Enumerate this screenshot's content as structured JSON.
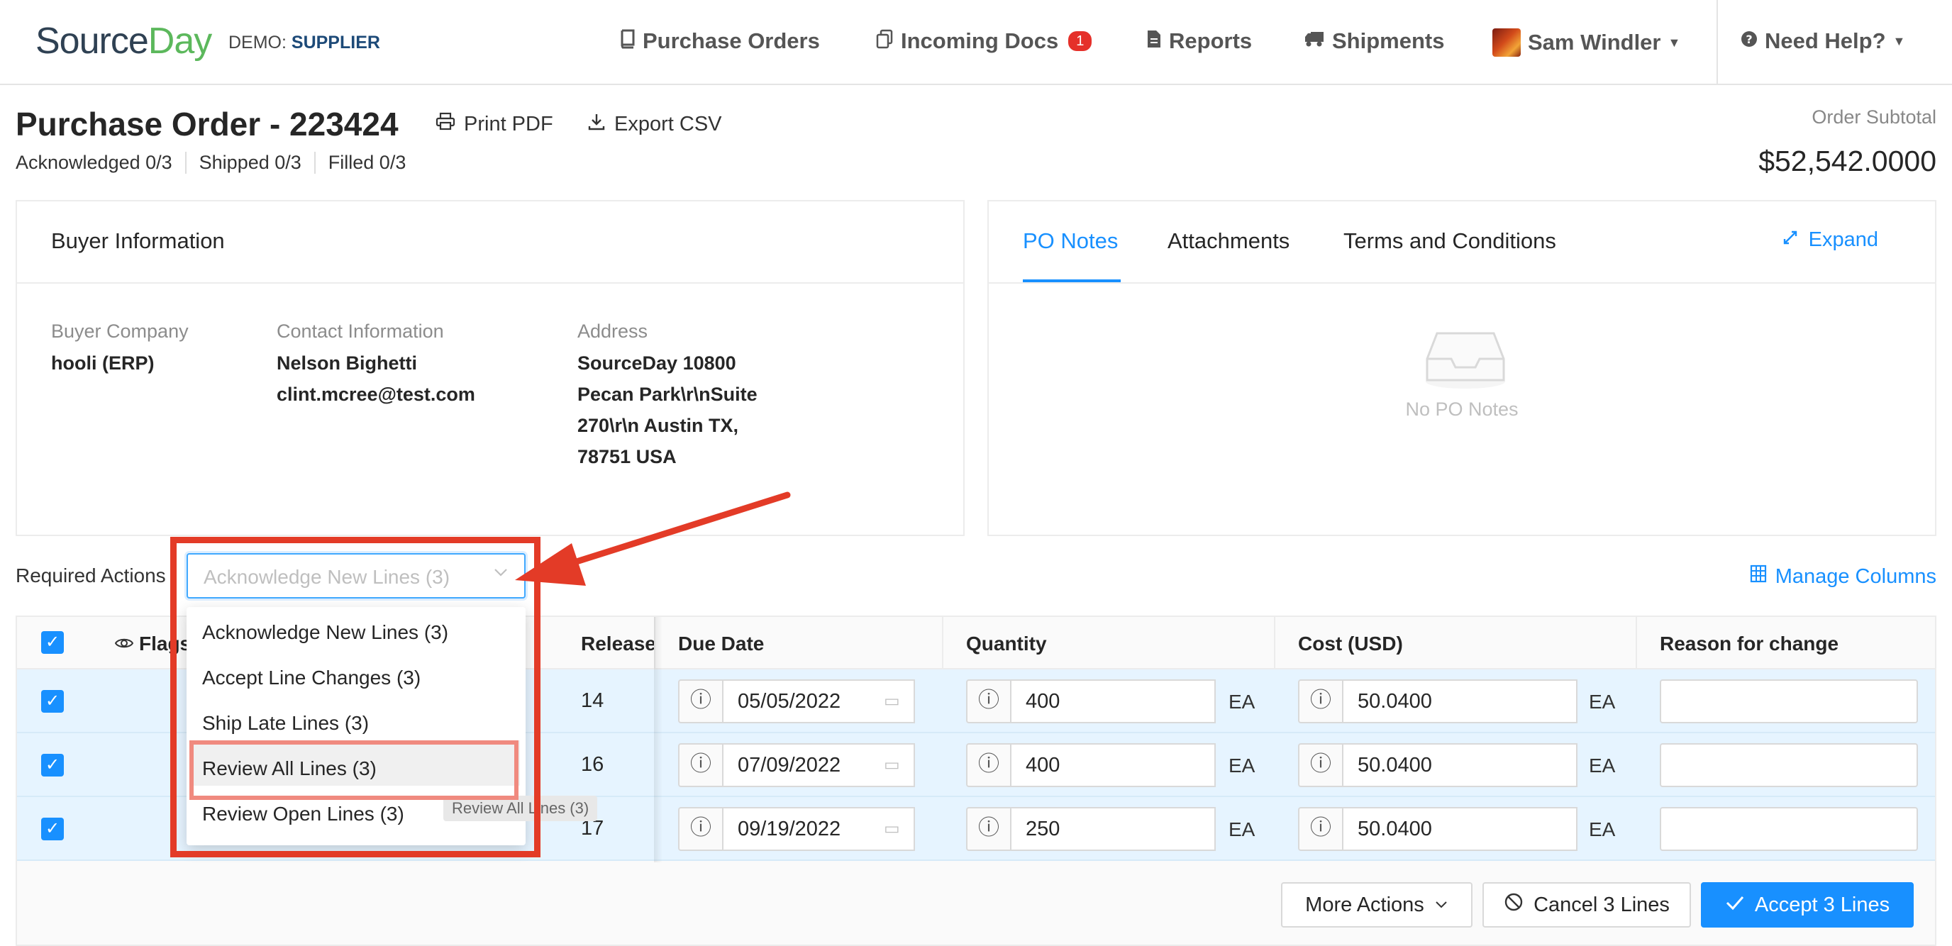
{
  "nav": {
    "logo_source": "Source",
    "logo_day": "Day",
    "demo_prefix": "DEMO:",
    "demo_name": "SUPPLIER",
    "purchase_orders": "Purchase Orders",
    "incoming_docs": "Incoming Docs",
    "incoming_badge": "1",
    "reports": "Reports",
    "shipments": "Shipments",
    "user": "Sam Windler",
    "help": "Need Help?"
  },
  "header": {
    "title": "Purchase Order - 223424",
    "print_pdf": "Print PDF",
    "export_csv": "Export CSV",
    "acknowledged": "Acknowledged 0/3",
    "shipped": "Shipped 0/3",
    "filled": "Filled 0/3",
    "subtotal_label": "Order Subtotal",
    "subtotal_value": "$52,542.0000"
  },
  "buyer": {
    "title": "Buyer Information",
    "company_label": "Buyer Company",
    "company_value": "hooli (ERP)",
    "contact_label": "Contact Information",
    "contact_name": "Nelson Bighetti",
    "contact_email": "clint.mcree@test.com",
    "address_label": "Address",
    "address_lines": [
      "SourceDay 10800",
      "Pecan Park\\r\\nSuite",
      "270\\r\\n Austin TX,",
      "78751 USA"
    ]
  },
  "notes": {
    "tabs": [
      "PO Notes",
      "Attachments",
      "Terms and Conditions"
    ],
    "expand": "Expand",
    "empty": "No PO Notes"
  },
  "actions": {
    "label": "Required Actions",
    "placeholder": "Acknowledge New Lines (3)",
    "manage_columns": "Manage Columns",
    "options": [
      "Acknowledge New Lines (3)",
      "Accept Line Changes (3)",
      "Ship Late Lines (3)",
      "Review All Lines (3)",
      "Review Open Lines (3)"
    ],
    "tooltip": "Review All Lines (3)"
  },
  "table": {
    "headers": {
      "flags": "Flags",
      "release": "Release",
      "due_date": "Due Date",
      "quantity": "Quantity",
      "cost": "Cost (USD)",
      "reason": "Reason for change"
    },
    "rows": [
      {
        "release": "14",
        "due_date": "05/05/2022",
        "quantity": "400",
        "qty_unit": "EA",
        "cost": "50.0400",
        "cost_unit": "EA"
      },
      {
        "release": "16",
        "due_date": "07/09/2022",
        "quantity": "400",
        "qty_unit": "EA",
        "cost": "50.0400",
        "cost_unit": "EA"
      },
      {
        "release": "17",
        "due_date": "09/19/2022",
        "quantity": "250",
        "qty_unit": "EA",
        "cost": "50.0400",
        "cost_unit": "EA"
      }
    ]
  },
  "footer": {
    "more_actions": "More Actions",
    "cancel": "Cancel 3 Lines",
    "accept": "Accept 3 Lines"
  },
  "colors": {
    "accent": "#1890ff",
    "annotation_red": "#e33b27",
    "badge_red": "#e5302a",
    "logo_green": "#5cb85c"
  }
}
